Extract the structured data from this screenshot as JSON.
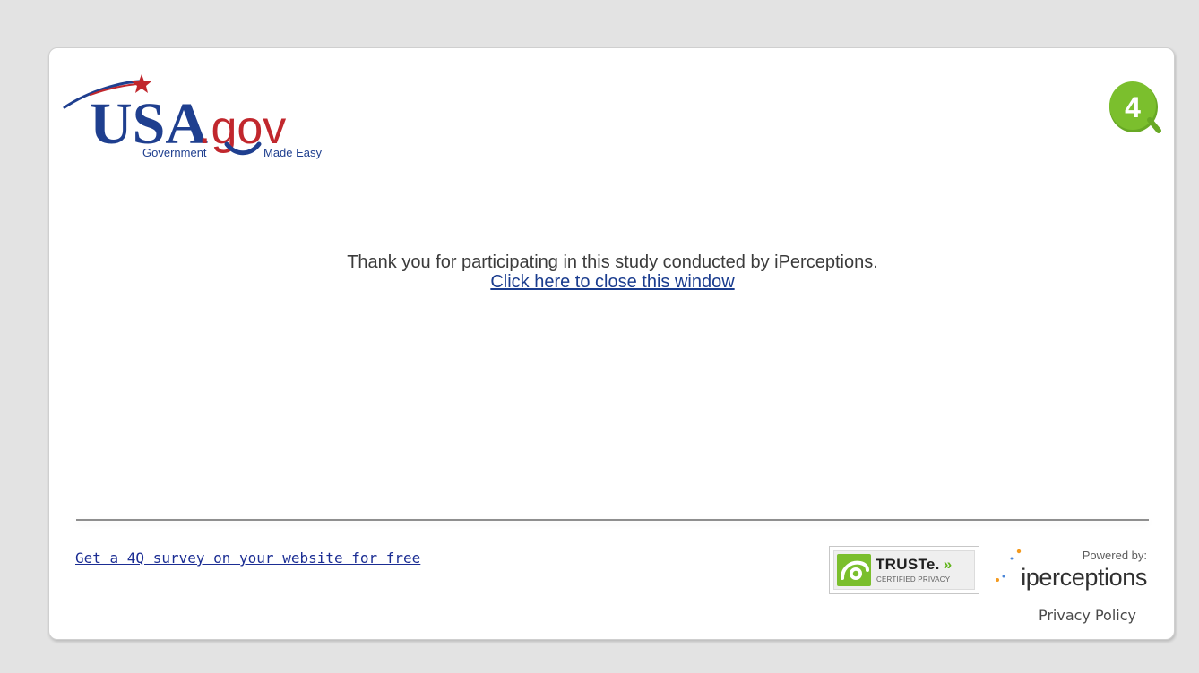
{
  "logo": {
    "main_text": "USA",
    "tld_text": ".gov",
    "tagline_left": "Government",
    "tagline_right": "Made Easy"
  },
  "badge": {
    "label": "4"
  },
  "message": {
    "text": "Thank you for participating in this study conducted by iPerceptions.",
    "close_link": "Click here to close this window"
  },
  "footer": {
    "survey_link": "Get a 4Q survey on your website for free",
    "truste_brand": "TRUSTe.",
    "truste_arrows": "»",
    "truste_sub": "CERTIFIED PRIVACY",
    "powered_by": "Powered by:",
    "iperceptions_brand": "iperceptions",
    "privacy_policy": "Privacy Policy"
  },
  "colors": {
    "page_bg": "#e3e3e3",
    "link_blue": "#1a3c8e",
    "logo_blue": "#1f3f8f",
    "logo_red": "#c1272d",
    "badge_green": "#74b72a"
  }
}
